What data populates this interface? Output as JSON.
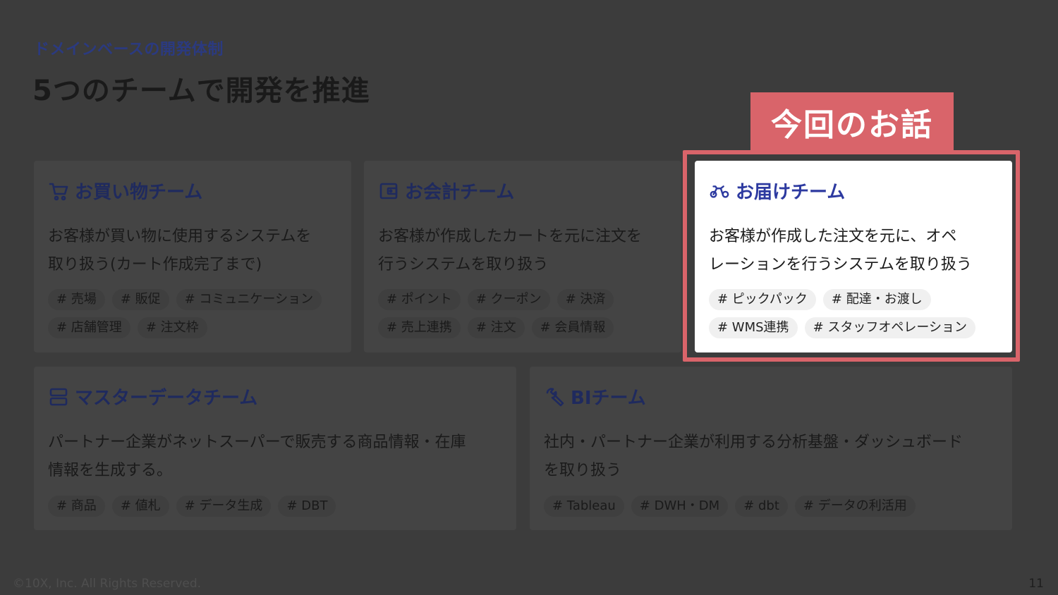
{
  "header": {
    "eyebrow": "ドメインベースの開発体制",
    "title": "5つのチームで開発を推進"
  },
  "callout": {
    "label": "今回のお話"
  },
  "teams": [
    {
      "name": "お買い物チーム",
      "icon": "cart-icon",
      "desc_lines": [
        "お客様が買い物に使用するシステムを",
        "取り扱う(カート作成完了まで)"
      ],
      "tags": [
        "# 売場",
        "# 販促",
        "# コミュニケーション",
        "# 店舗管理",
        "# 注文枠"
      ]
    },
    {
      "name": "お会計チーム",
      "icon": "wallet-icon",
      "desc_lines": [
        "お客様が作成したカートを元に注文を",
        "行うシステムを取り扱う"
      ],
      "tags": [
        "# ポイント",
        "# クーポン",
        "# 決済",
        "# 売上連携",
        "# 注文",
        "# 会員情報"
      ]
    },
    {
      "name": "お届けチーム",
      "icon": "delivery-bike-icon",
      "desc_lines": [
        "お客様が作成した注文を元に、オペ",
        "レーションを行うシステムを取り扱う"
      ],
      "tags": [
        "# ピックパック",
        "# 配達・お渡し",
        "# WMS連携",
        "# スタッフオペレーション"
      ]
    },
    {
      "name": "マスターデータチーム",
      "icon": "database-icon",
      "desc_lines": [
        "パートナー企業がネットスーパーで販売する商品情報・在庫",
        "情報を生成する。"
      ],
      "tags": [
        "# 商品",
        "# 値札",
        "# データ生成",
        "# DBT"
      ]
    },
    {
      "name": "BIチーム",
      "icon": "wrench-icon",
      "desc_lines": [
        "社内・パートナー企業が利用する分析基盤・ダッシュボード",
        "を取り扱う"
      ],
      "tags": [
        "# Tableau",
        "# DWH・DM",
        "# dbt",
        "# データの利活用"
      ]
    }
  ],
  "footer": {
    "copyright": "©10X, Inc. All Rights Reserved.",
    "page_number": "11"
  },
  "colors": {
    "accent": "#2d3aa0",
    "highlight_frame": "#d9646a",
    "overlay_background": "#3c3c3c"
  }
}
